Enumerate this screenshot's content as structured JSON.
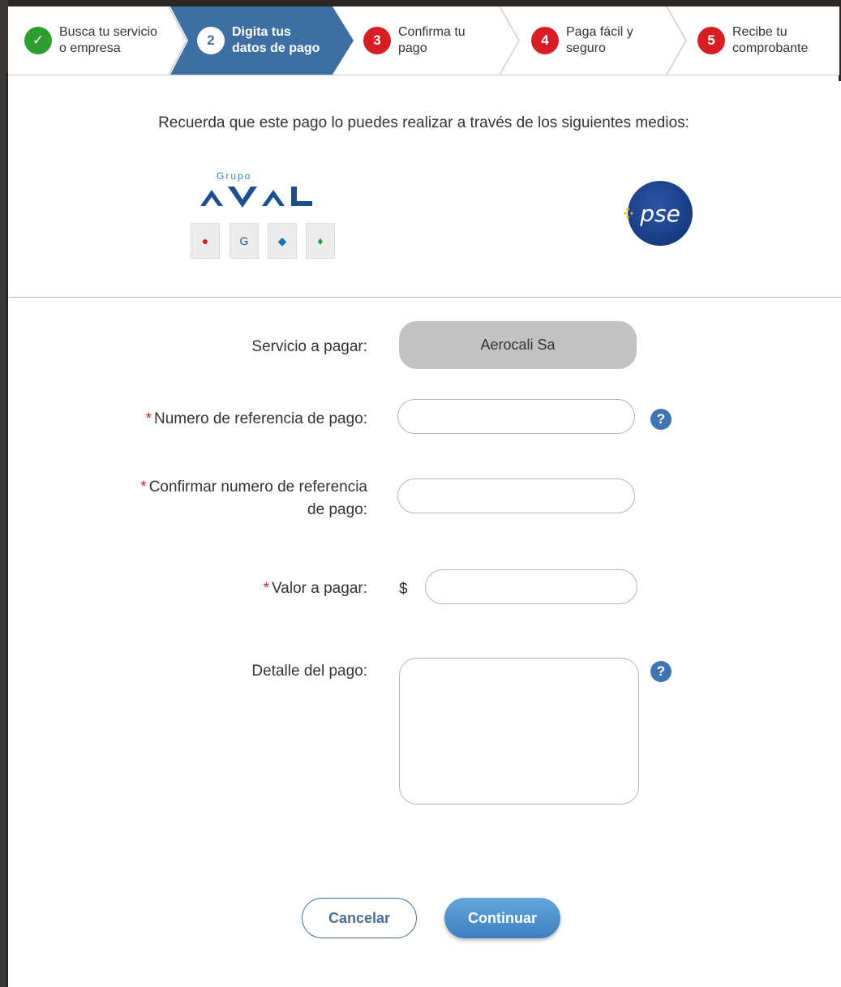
{
  "stepper": {
    "steps": [
      {
        "number": "✓",
        "label_line1": "Busca tu servicio",
        "label_line2": "o empresa",
        "state": "done"
      },
      {
        "number": "2",
        "label_line1": "Digita tus",
        "label_line2": "datos de pago",
        "state": "current"
      },
      {
        "number": "3",
        "label_line1": "Confirma tu",
        "label_line2": "pago",
        "state": "pending"
      },
      {
        "number": "4",
        "label_line1": "Paga fácil y",
        "label_line2": "seguro",
        "state": "pending"
      },
      {
        "number": "5",
        "label_line1": "Recibe tu",
        "label_line2": "comprobante",
        "state": "pending"
      }
    ]
  },
  "media": {
    "intro": "Recuerda que este pago lo puedes realizar a través de los siguientes medios:",
    "aval_logo": {
      "grupo": "Grupo",
      "name": "AVAL"
    },
    "pse_logo": "pse"
  },
  "form": {
    "service_label": "Servicio a pagar:",
    "service_value": "Aerocali Sa",
    "reference_label": "Numero de referencia de pago:",
    "confirm_label_line1": "Confirmar numero de referencia",
    "confirm_label_line2": "de pago:",
    "amount_label": "Valor a pagar:",
    "currency_symbol": "$",
    "detail_label": "Detalle del pago:",
    "required_mark": "*",
    "help_glyph": "?"
  },
  "actions": {
    "cancel_label": "Cancelar",
    "continue_label": "Continuar"
  },
  "colors": {
    "step_active": "#3e6fa3",
    "step_done": "#2f9e2f",
    "step_pending": "#d81e24",
    "primary_button": "#4a8fcf",
    "help_icon": "#3f76b2"
  }
}
